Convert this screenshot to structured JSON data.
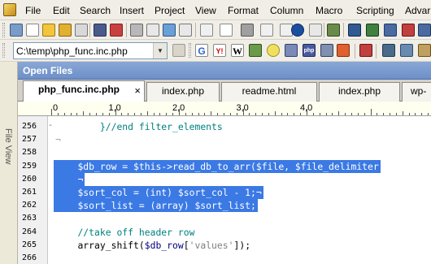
{
  "window": {
    "app_name": "UltraEdit"
  },
  "menubar": {
    "items": [
      "File",
      "Edit",
      "Search",
      "Insert",
      "Project",
      "View",
      "Format",
      "Column",
      "Macro",
      "Scripting",
      "Advar"
    ]
  },
  "toolbar_path": {
    "value": "C:\\temp\\php_func.inc.php"
  },
  "web_toolbar": {
    "labels": [
      "G",
      "Y!",
      "W",
      "php"
    ]
  },
  "side_panel": {
    "file_view_label": "File View"
  },
  "open_files_panel": {
    "title": "Open Files"
  },
  "tabs": [
    {
      "label": "php_func.inc.php",
      "active": true,
      "close_glyph": "×"
    },
    {
      "label": "index.php",
      "active": false
    },
    {
      "label": "readme.html",
      "active": false
    },
    {
      "label": "index.php",
      "active": false
    },
    {
      "label": "wp-",
      "active": false
    }
  ],
  "ruler": {
    "labels": [
      "0",
      "1,0",
      "2,0",
      "3,0",
      "4,0"
    ]
  },
  "editor": {
    "lines": [
      {
        "number": "256",
        "indent": "        ",
        "parts": [
          {
            "t": "}//end filter_elements",
            "k": "c-com"
          }
        ],
        "selected": false
      },
      {
        "number": "257",
        "indent": "",
        "parts": [
          {
            "t": "¬",
            "k": "nl"
          }
        ],
        "selected": false
      },
      {
        "number": "258",
        "indent": "",
        "parts": [],
        "selected": false
      },
      {
        "number": "259",
        "indent": "    ",
        "parts": [
          {
            "t": "$db_row = $this->read_db_to_arr($file, $file_delimiter",
            "k": "s-txt"
          }
        ],
        "selected": true
      },
      {
        "number": "260",
        "indent": "    ",
        "parts": [
          {
            "t": "¬",
            "k": "nl-sel"
          }
        ],
        "selected": true
      },
      {
        "number": "261",
        "indent": "    ",
        "parts": [
          {
            "t": "$sort_col = (int) $sort_col - 1;¬",
            "k": "s-txt"
          }
        ],
        "selected": true
      },
      {
        "number": "262",
        "indent": "    ",
        "parts": [
          {
            "t": "$sort_list = (array) $sort_list;",
            "k": "s-txt"
          }
        ],
        "selected": true
      },
      {
        "number": "263",
        "indent": "",
        "parts": [],
        "selected": false
      },
      {
        "number": "264",
        "indent": "    ",
        "parts": [
          {
            "t": "//take off header row",
            "k": "c-com"
          }
        ],
        "selected": false
      },
      {
        "number": "265",
        "indent": "    ",
        "parts": [
          {
            "t": "array_shift(",
            "k": "c-fn"
          },
          {
            "t": "$db_row",
            "k": "c-var"
          },
          {
            "t": "[",
            "k": "c-pl"
          },
          {
            "t": "'values'",
            "k": "c-str"
          },
          {
            "t": "]);",
            "k": "c-pl"
          }
        ],
        "selected": false
      },
      {
        "number": "266",
        "indent": "",
        "parts": [],
        "selected": false
      }
    ]
  }
}
